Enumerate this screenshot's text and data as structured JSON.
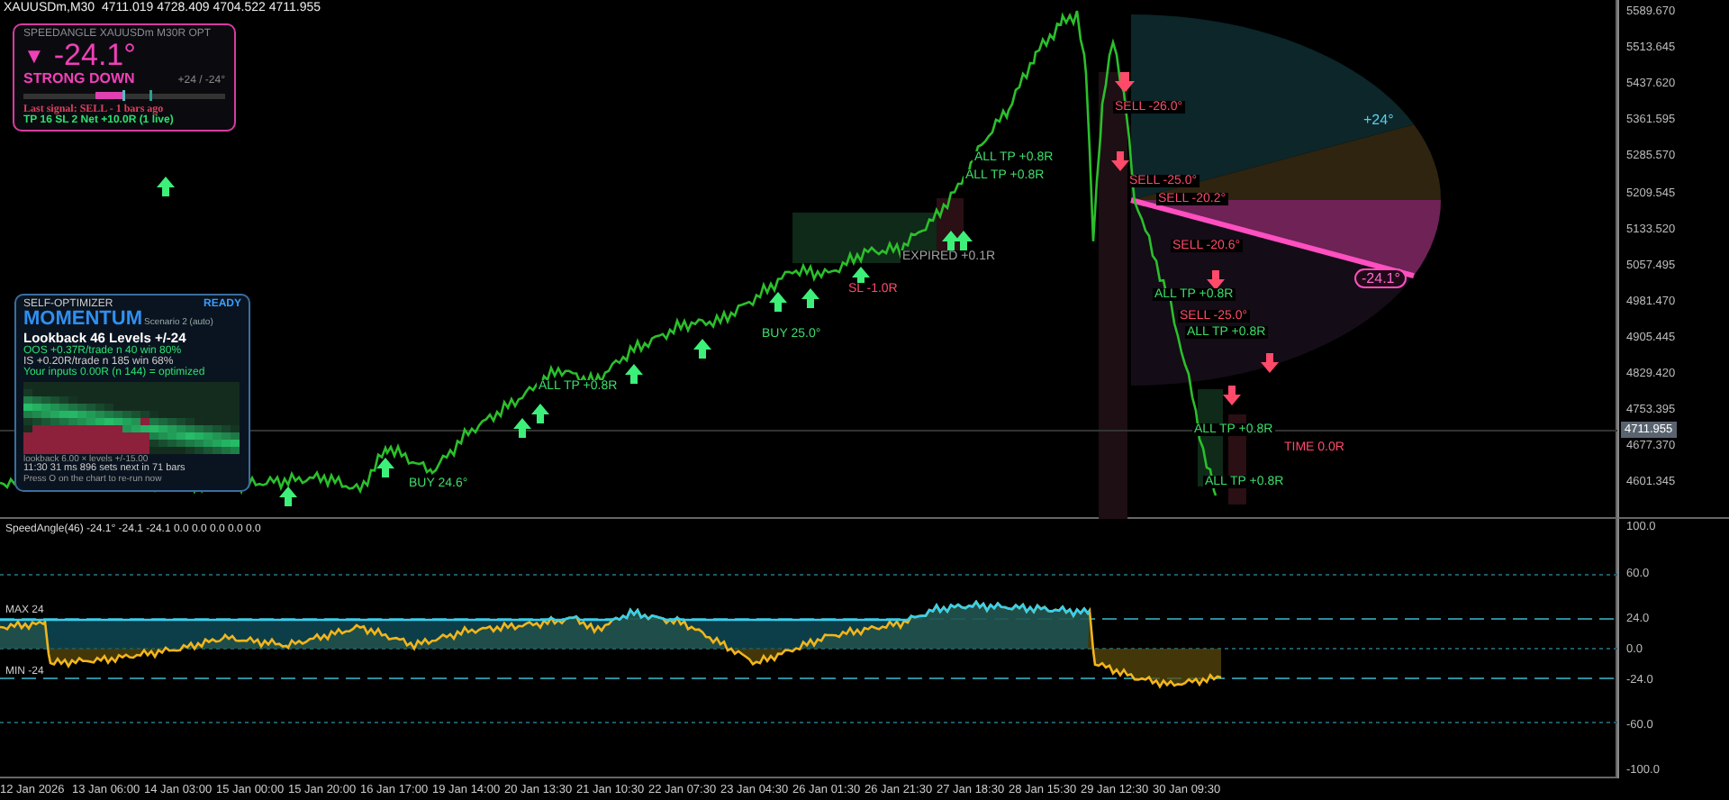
{
  "header": {
    "symbol": "XAUUSDm,M30",
    "ohlc": "4711.019 4728.409 4704.522 4711.955"
  },
  "speed_panel": {
    "title": "SPEEDANGLE  XAUUSDm  M30R  OPT",
    "arrow": "▼",
    "angle": "-24.1°",
    "state": "STRONG DOWN",
    "range": "+24 / -24°",
    "last_signal": "Last signal: SELL  -  1 bars ago",
    "stats": "TP 16   SL 2   Net +10.0R   (1 live)"
  },
  "optimizer": {
    "title": "SELF-OPTIMIZER",
    "status": "READY",
    "mode": "MOMENTUM",
    "scenario": "Scenario 2 (auto)",
    "params": "Lookback 46    Levels +/-24",
    "oos": "OOS   +0.37R/trade   n 40   win 80%",
    "is": "IS   +0.20R/trade   n 185   win 68%",
    "inputs": "Your inputs  0.00R (n 144)   =   optimized",
    "axes": "lookback 6.00   ×   levels +/-15.00",
    "timing": "11:30   31 ms   896 sets   next in 71 bars",
    "hint": "Press O on the chart to re-run now"
  },
  "gauge": {
    "upper": "+24°",
    "current": "-24.1°"
  },
  "annotations": [
    {
      "kind": "sell",
      "text": "SELL -26.0°"
    },
    {
      "kind": "sell",
      "text": "SELL -25.0°"
    },
    {
      "kind": "sell",
      "text": "SELL -20.2°"
    },
    {
      "kind": "sell",
      "text": "SELL -20.6°"
    },
    {
      "kind": "tp",
      "text": "ALL TP +0.8R"
    },
    {
      "kind": "sell",
      "text": "SELL -25.0°"
    },
    {
      "kind": "tp",
      "text": "ALL TP +0.8R"
    },
    {
      "kind": "tp",
      "text": "ALL TP +0.8R"
    },
    {
      "kind": "sl",
      "text": "TIME 0.0R"
    },
    {
      "kind": "tp",
      "text": "ALL TP +0.8R"
    },
    {
      "kind": "tp",
      "text": "ALL TP +0.8R"
    },
    {
      "kind": "tp",
      "text": "ALL TP +0.8R"
    },
    {
      "kind": "expired",
      "text": "EXPIRED +0.1R"
    },
    {
      "kind": "sl",
      "text": "SL -1.0R"
    },
    {
      "kind": "buy",
      "text": "BUY 25.0°"
    },
    {
      "kind": "tp",
      "text": "ALL TP +0.8R"
    },
    {
      "kind": "buy",
      "text": "BUY 24.6°"
    }
  ],
  "price_axis": {
    "labels": [
      "5589.670",
      "5513.645",
      "5437.620",
      "5361.595",
      "5285.570",
      "5209.545",
      "5133.520",
      "5057.495",
      "4981.470",
      "4905.445",
      "4829.420",
      "4753.395",
      "4677.370",
      "4601.345"
    ],
    "current": "4711.955"
  },
  "indicator": {
    "label": "SpeedAngle(46)  -24.1°  -24.1  -24.1  0.0  0.0  0.0  0.0  0.0",
    "max_label": "MAX 24",
    "min_label": "MIN -24",
    "axis_labels": [
      "100.0",
      "60.0",
      "24.0",
      "0.0",
      "-24.0",
      "-60.0",
      "-100.0"
    ]
  },
  "time_axis": [
    "12 Jan 2026",
    "13 Jan 06:00",
    "14 Jan 03:00",
    "15 Jan 00:00",
    "15 Jan 20:00",
    "16 Jan 17:00",
    "19 Jan 14:00",
    "20 Jan 13:30",
    "21 Jan 10:30",
    "22 Jan 07:30",
    "23 Jan 04:30",
    "26 Jan 01:30",
    "26 Jan 21:30",
    "27 Jan 18:30",
    "28 Jan 15:30",
    "29 Jan 12:30",
    "30 Jan 09:30"
  ]
}
